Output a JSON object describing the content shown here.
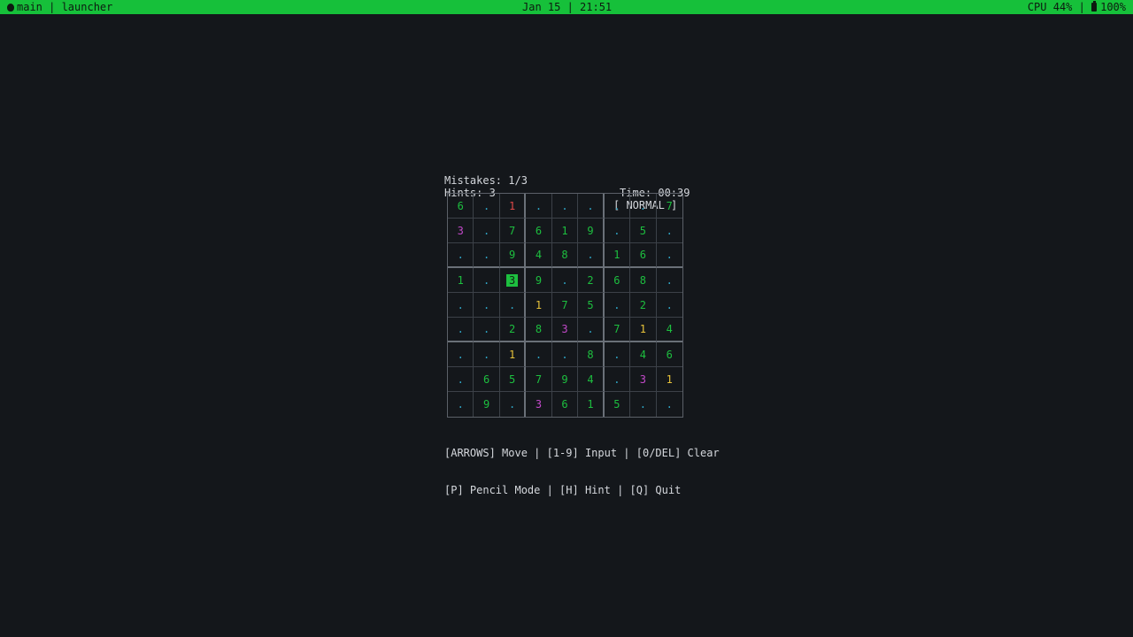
{
  "topbar": {
    "left": "main | launcher",
    "center": "Jan 15 | 21:51",
    "cpu": "CPU 44%",
    "separator": " | ",
    "battery": "100%"
  },
  "hud": {
    "mistakes": "Mistakes: 1/3",
    "time": "Time: 00:39",
    "hints": "Hints: 3",
    "mode": "[ NORMAL ]"
  },
  "board": {
    "rows": [
      [
        "6",
        ".",
        "1",
        ".",
        ".",
        ".",
        ".",
        ".",
        "7"
      ],
      [
        "3",
        ".",
        "7",
        "6",
        "1",
        "9",
        ".",
        "5",
        "."
      ],
      [
        ".",
        ".",
        "9",
        "4",
        "8",
        ".",
        "1",
        "6",
        "."
      ],
      [
        "1",
        ".",
        "3",
        "9",
        ".",
        "2",
        "6",
        "8",
        "."
      ],
      [
        ".",
        ".",
        ".",
        "1",
        "7",
        "5",
        ".",
        "2",
        "."
      ],
      [
        ".",
        ".",
        "2",
        "8",
        "3",
        ".",
        "7",
        "1",
        "4"
      ],
      [
        ".",
        ".",
        "1",
        ".",
        ".",
        "8",
        ".",
        "4",
        "6"
      ],
      [
        ".",
        "6",
        "5",
        "7",
        "9",
        "4",
        ".",
        "3",
        "1"
      ],
      [
        ".",
        "9",
        ".",
        "3",
        "6",
        "1",
        "5",
        ".",
        "."
      ]
    ],
    "styles": [
      [
        "given",
        "empty",
        "error",
        "empty",
        "empty",
        "empty",
        "empty",
        "empty",
        "given"
      ],
      [
        "user",
        "empty",
        "given",
        "given",
        "given",
        "given",
        "empty",
        "given",
        "empty"
      ],
      [
        "empty",
        "empty",
        "given",
        "given",
        "given",
        "empty",
        "given",
        "given",
        "empty"
      ],
      [
        "given",
        "empty",
        "selected",
        "given",
        "empty",
        "given",
        "given",
        "given",
        "empty"
      ],
      [
        "empty",
        "empty",
        "empty",
        "pencil",
        "given",
        "given",
        "empty",
        "given",
        "empty"
      ],
      [
        "empty",
        "empty",
        "given",
        "given",
        "user",
        "empty",
        "given",
        "pencil",
        "given"
      ],
      [
        "empty",
        "empty",
        "pencil",
        "empty",
        "empty",
        "given",
        "empty",
        "given",
        "given"
      ],
      [
        "empty",
        "given",
        "given",
        "given",
        "given",
        "given",
        "empty",
        "user",
        "pencil"
      ],
      [
        "empty",
        "given",
        "empty",
        "user",
        "given",
        "given",
        "given",
        "empty",
        "empty"
      ]
    ],
    "selected_cell": {
      "row": 4,
      "col": 3
    },
    "colors": {
      "given": "#1dbf3f",
      "empty": "#2fa8c9",
      "error": "#e04848",
      "user": "#c249c9",
      "pencil": "#e6c23a"
    }
  },
  "help": {
    "line1": "[ARROWS] Move | [1-9] Input | [0/DEL] Clear",
    "line2": "[P] Pencil Mode | [H] Hint | [Q] Quit"
  },
  "colors": {
    "background": "#14171b",
    "status_bar": "#16c03a",
    "text": "#d4d7dc"
  }
}
